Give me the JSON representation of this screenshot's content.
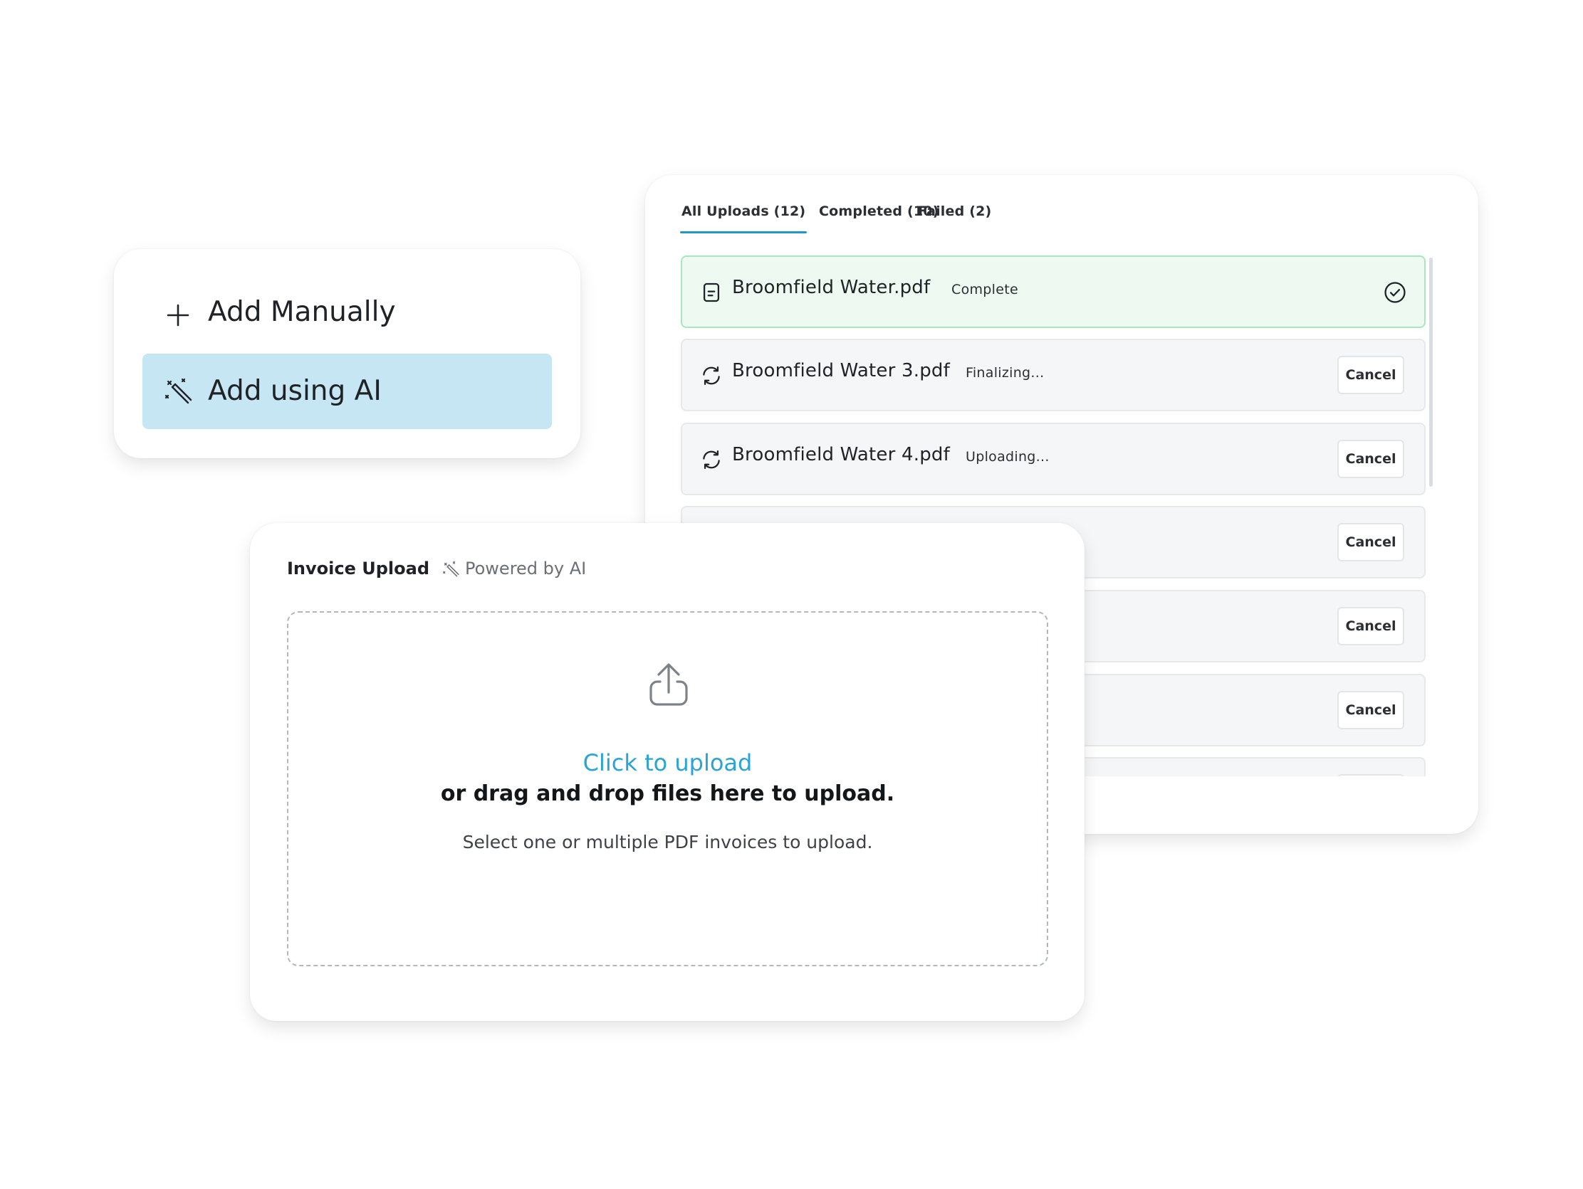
{
  "uploads": {
    "tabs": [
      {
        "label": "All Uploads (12)",
        "active": true
      },
      {
        "label": "Completed (10)",
        "active": false
      },
      {
        "label": "Failed (2)",
        "active": false
      }
    ],
    "items": [
      {
        "filename": "Broomfield Water.pdf",
        "status": "Complete",
        "state": "complete",
        "icon": "document-icon",
        "action": "check-circle-icon"
      },
      {
        "filename": "Broomfield Water 3.pdf",
        "status": "Finalizing...",
        "state": "processing",
        "icon": "refresh-icon",
        "action_label": "Cancel"
      },
      {
        "filename": "Broomfield Water 4.pdf",
        "status": "Uploading...",
        "state": "processing",
        "icon": "refresh-icon",
        "action_label": "Cancel"
      },
      {
        "action_label": "Cancel"
      },
      {
        "action_label": "Cancel"
      },
      {
        "action_label": "Cancel"
      },
      {
        "action_label": ""
      }
    ],
    "colors": {
      "tab_indicator": "#2596c9",
      "complete_bg": "#eefaf1",
      "complete_border": "#a8e6bd"
    }
  },
  "add_menu": {
    "items": [
      {
        "label": "Add Manually",
        "icon": "plus-icon",
        "selected": false
      },
      {
        "label": "Add using AI",
        "icon": "magic-wand-icon",
        "selected": true
      }
    ],
    "colors": {
      "selected_bg": "#c6e6f4"
    }
  },
  "invoice_upload": {
    "title": "Invoice Upload",
    "powered_by": "Powered by AI",
    "powered_icon": "magic-wand-icon",
    "dropzone": {
      "icon": "upload-icon",
      "click_text": "Click to upload",
      "drag_text": "or drag and drop files here to upload.",
      "hint": "Select one or multiple PDF invoices to upload."
    },
    "colors": {
      "link": "#2aa4d6"
    }
  }
}
